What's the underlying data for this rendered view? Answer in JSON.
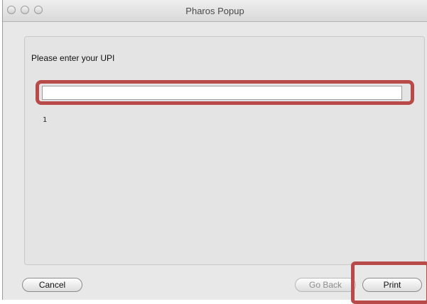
{
  "window": {
    "title": "Pharos Popup"
  },
  "form": {
    "prompt": "Please enter your UPI",
    "upi_value": "",
    "counter": "1"
  },
  "buttons": {
    "cancel": "Cancel",
    "go_back": "Go Back",
    "print": "Print"
  },
  "colors": {
    "highlight": "#b84a4a"
  }
}
